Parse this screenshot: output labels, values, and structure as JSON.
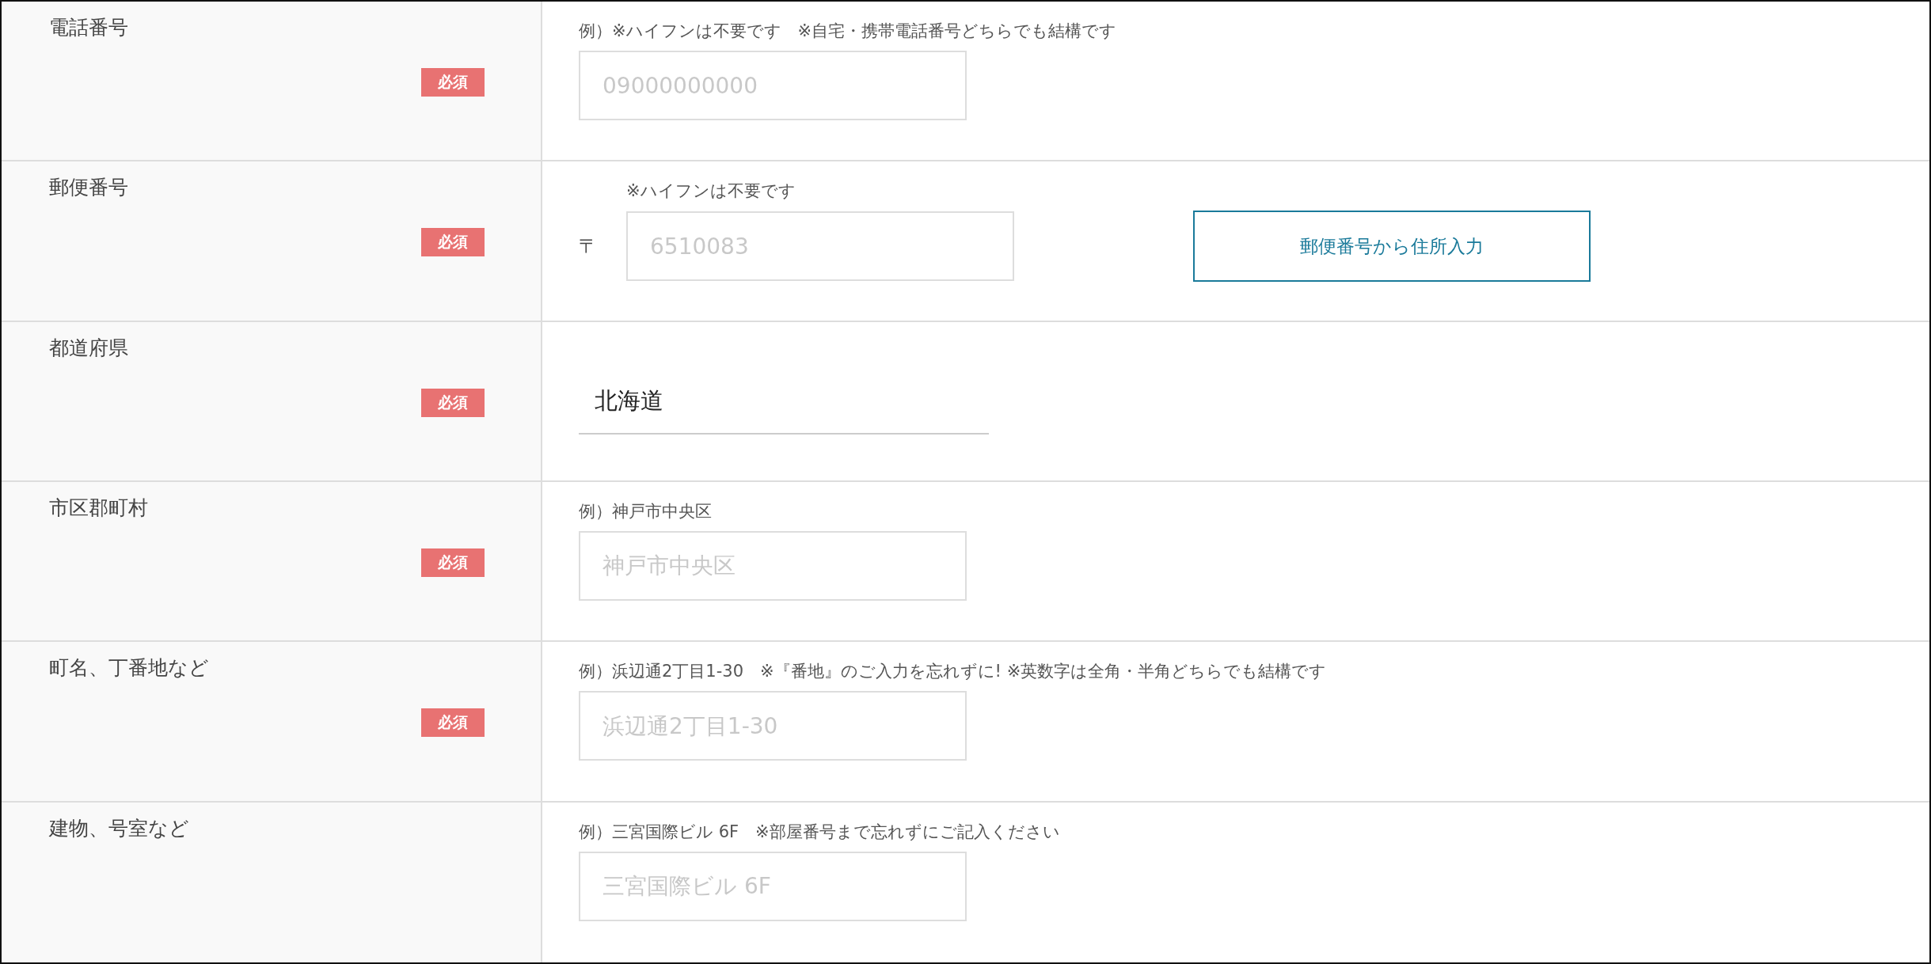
{
  "rows": [
    {
      "label": "電話番号",
      "required": true,
      "required_badge": "必須",
      "note": "例）※ハイフンは不要です　※自宅・携帯電話番号どちらでも結構です",
      "field": {
        "kind": "input",
        "placeholder": "09000000000"
      }
    },
    {
      "label": "郵便番号",
      "required": true,
      "required_badge": "必須",
      "note": "※ハイフンは不要です",
      "field": {
        "kind": "postal",
        "prefix": "〒",
        "placeholder": "6510083"
      },
      "button": "郵便番号から住所入力"
    },
    {
      "label": "都道府県",
      "required": true,
      "required_badge": "必須",
      "field": {
        "kind": "select",
        "value": "北海道"
      }
    },
    {
      "label": "市区郡町村",
      "required": true,
      "required_badge": "必須",
      "note": "例）神戸市中央区",
      "field": {
        "kind": "input",
        "placeholder": "神戸市中央区"
      }
    },
    {
      "label": "町名、丁番地など",
      "required": true,
      "required_badge": "必須",
      "note": "例）浜辺通2丁目1-30　※『番地』のご入力を忘れずに! ※英数字は全角・半角どちらでも結構です",
      "field": {
        "kind": "input",
        "placeholder": "浜辺通2丁目1-30"
      }
    },
    {
      "label": "建物、号室など",
      "required": false,
      "note": "例）三宮国際ビル 6F　※部屋番号まで忘れずにご記入ください",
      "field": {
        "kind": "input",
        "placeholder": "三宮国際ビル 6F"
      }
    }
  ]
}
